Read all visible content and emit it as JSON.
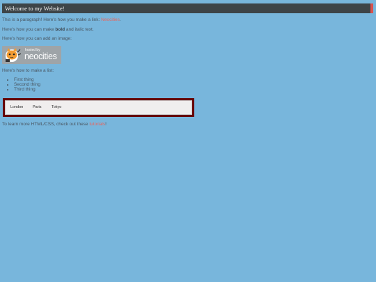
{
  "header": {
    "title": "Welcome to my Website!"
  },
  "para1": {
    "text": "This is a paragraph! Here's how you make a link: ",
    "link": "Neocities",
    "end": "."
  },
  "para2": {
    "before": "Here's how you can make ",
    "bold": "bold",
    "after": " and italic text."
  },
  "para3": {
    "text": "Here's how you can add an image:"
  },
  "badge": {
    "small": "hosted by",
    "big": "neocities"
  },
  "para4": {
    "text": "Here's how to make a list:"
  },
  "list": {
    "items": [
      "First thing",
      "Second thing",
      "Third thing"
    ]
  },
  "nav": {
    "items": [
      "London",
      "Paris",
      "Tokyo"
    ]
  },
  "footer": {
    "before": "To learn more HTML/CSS, check out these ",
    "link": "tutorials",
    "after": "!"
  },
  "colors": {
    "background": "#78b6dc",
    "header_bg": "#3d4448",
    "header_accent": "#d9534f",
    "link": "#e8645c",
    "nav_border": "#660000"
  }
}
